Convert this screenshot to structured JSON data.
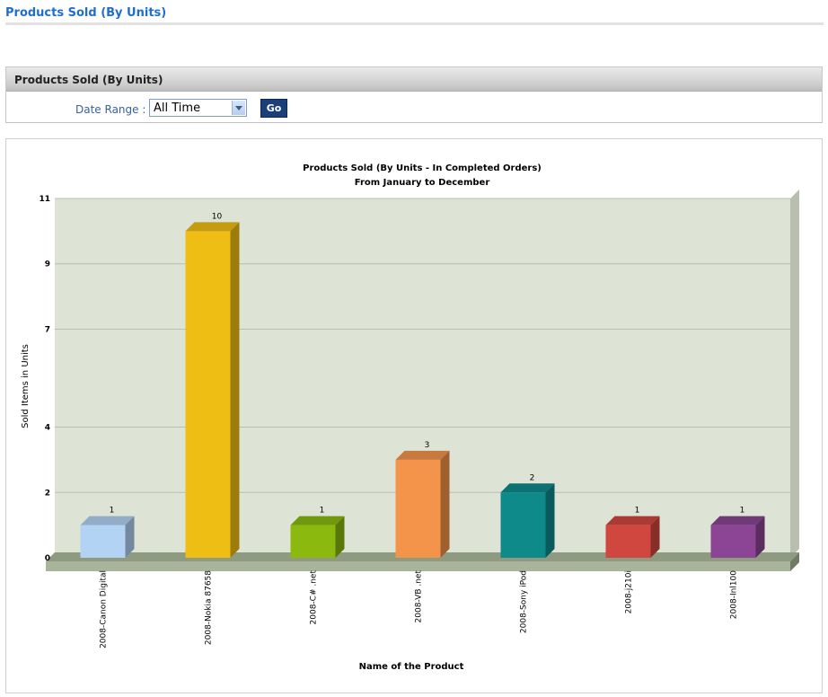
{
  "page": {
    "title": "Products Sold (By Units)"
  },
  "filter_panel": {
    "header": "Products Sold (By Units)",
    "date_range_label": "Date Range :",
    "date_range_value": "All Time",
    "go_label": "Go"
  },
  "chart_data": {
    "type": "bar",
    "title": "Products Sold (By Units - In Completed Orders)",
    "subtitle": "From January to December",
    "xlabel": "Name of the Product",
    "ylabel": "Sold Items in Units",
    "categories": [
      "2008-Canon Digital",
      "2008-Nokia 87658",
      "2008-C# .net",
      "2008-VB .net",
      "2008-Sony iPod",
      "2008-j210i",
      "2008-Inl100"
    ],
    "values": [
      1,
      10,
      1,
      3,
      2,
      1,
      1
    ],
    "value_labels": [
      "1",
      "10",
      "1",
      "3",
      "2",
      "1",
      "1"
    ],
    "y_ticks": [
      "0",
      "2",
      "4",
      "7",
      "9",
      "11"
    ],
    "ylim": [
      0,
      11
    ],
    "grid": true,
    "colors": {
      "plot_bg": "#dde3d5",
      "floor": "#a9b59b",
      "gridline": "#b7bfae",
      "bars": [
        "#b3d3f5",
        "#efbe14",
        "#8bb90d",
        "#f4944a",
        "#0e8a8b",
        "#d0473f",
        "#8b4594"
      ]
    }
  }
}
